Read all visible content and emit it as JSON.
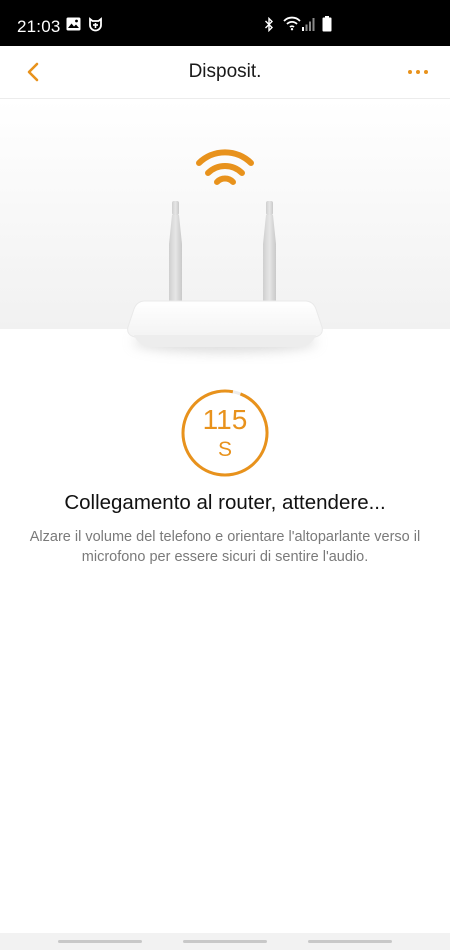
{
  "status_bar": {
    "time": "21:03",
    "icons": [
      "gallery-icon",
      "mi-home-icon",
      "bluetooth-icon",
      "wifi-icon",
      "signal-icon",
      "battery-icon"
    ]
  },
  "header": {
    "title": "Disposit.",
    "back_icon": "chevron-left-icon",
    "more_icon": "more-horizontal-icon"
  },
  "illustration": {
    "subject": "router-with-wifi-signal"
  },
  "countdown": {
    "value": "115",
    "unit": "S",
    "remaining_fraction": 0.97
  },
  "message": {
    "title": "Collegamento al router, attendere...",
    "body": "Alzare il volume del telefono e orientare l'altoparlante verso il microfono per essere sicuri di sentire l'audio."
  },
  "colors": {
    "accent": "#e8921c",
    "status_bar_bg": "#000000",
    "text_primary": "#111111",
    "text_secondary": "#7a7a7a"
  }
}
